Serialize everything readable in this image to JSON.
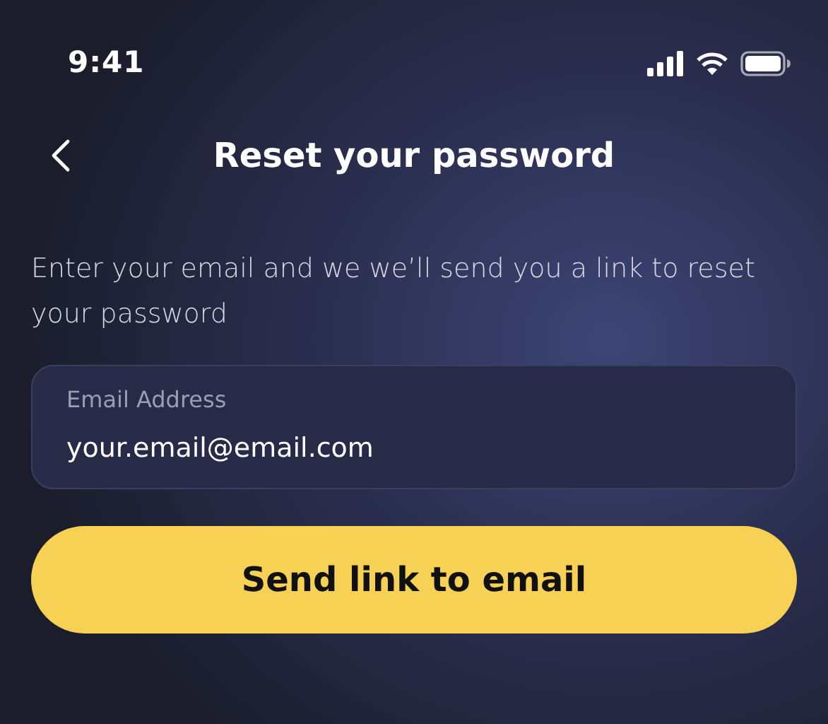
{
  "status_bar": {
    "time": "9:41"
  },
  "header": {
    "title": "Reset your password"
  },
  "description": "Enter your email and we we’ll send you a link to reset your password",
  "email_field": {
    "label": "Email Address",
    "value": "your.email@email.com"
  },
  "submit_button": {
    "label": "Send link to email"
  }
}
